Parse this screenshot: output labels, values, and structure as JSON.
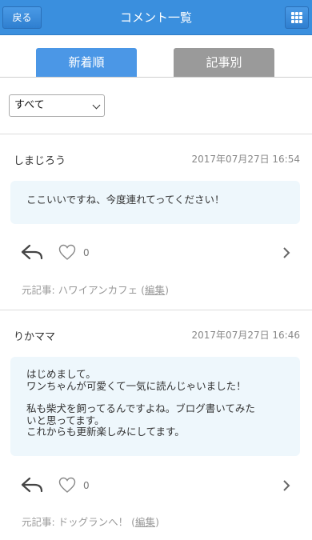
{
  "header": {
    "back_label": "戻る",
    "title": "コメント一覧",
    "menu_icon": "grid-icon"
  },
  "tabs": [
    {
      "label": "新着順",
      "active": true
    },
    {
      "label": "記事別",
      "active": false
    }
  ],
  "filter": {
    "selected": "すべて"
  },
  "comments": [
    {
      "author": "しまじろう",
      "timestamp": "2017年07月27日 16:54",
      "body": [
        "ここいいですね、今度連れてってください！"
      ],
      "likes": "0",
      "source_prefix": "元記事: ハワイアンカフェ (",
      "source_link": "編集",
      "source_suffix": ")"
    },
    {
      "author": "りかママ",
      "timestamp": "2017年07月27日 16:46",
      "body": [
        "はじめまして。",
        "ワンちゃんが可愛くて一気に読んじゃいました！",
        "",
        "私も柴犬を飼ってるんですよね。ブログ書いてみた",
        "いと思ってます。",
        "これからも更新楽しみにしてます。"
      ],
      "likes": "0",
      "source_prefix": "元記事: ドッグランへ！ (",
      "source_link": "編集",
      "source_suffix": ")"
    }
  ],
  "colors": {
    "header": "#3a8fde",
    "tab_active": "#4b97e6",
    "tab_inactive": "#9a9a9a",
    "bubble": "#eef7fc"
  }
}
